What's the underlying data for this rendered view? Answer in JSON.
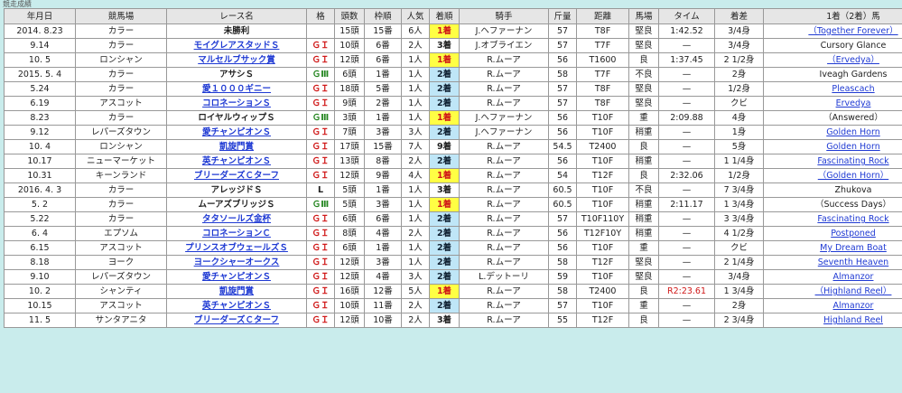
{
  "caption": "競走成績",
  "headers": [
    "年月日",
    "競馬場",
    "レース名",
    "格",
    "頭数",
    "枠順",
    "人気",
    "着順",
    "騎手",
    "斤量",
    "距離",
    "馬場",
    "タイム",
    "着差",
    "1着（2着）馬"
  ],
  "rows": [
    {
      "date": "2014. 8.23",
      "course": "カラー",
      "race": "未勝利",
      "race_link": false,
      "grade": "",
      "grade_class": "",
      "runners": "15頭",
      "draw": "15番",
      "pop": "6人",
      "finish": "1着",
      "finish_class": "win",
      "jockey": "J.ヘファーナン",
      "weight": "57",
      "distance": "T8F",
      "going": "堅良",
      "time": "1:42.52",
      "time_red": false,
      "margin": "3/4身",
      "horse": "（Together Forever）",
      "horse_link": true
    },
    {
      "date": "9.14",
      "course": "カラー",
      "race": "モイグレアスタッドＳ",
      "race_link": true,
      "grade": "ＧＩ",
      "grade_class": "g1",
      "runners": "10頭",
      "draw": "6番",
      "pop": "2人",
      "finish": "3着",
      "finish_class": "other",
      "jockey": "J.オブライエン",
      "weight": "57",
      "distance": "T7F",
      "going": "堅良",
      "time": "—",
      "time_red": false,
      "margin": "3/4身",
      "horse": "Cursory Glance",
      "horse_link": false
    },
    {
      "date": "10. 5",
      "course": "ロンシャン",
      "race": "マルセルブサック賞",
      "race_link": true,
      "grade": "ＧＩ",
      "grade_class": "g1",
      "runners": "12頭",
      "draw": "6番",
      "pop": "1人",
      "finish": "1着",
      "finish_class": "win",
      "jockey": "R.ムーア",
      "weight": "56",
      "distance": "T1600",
      "going": "良",
      "time": "1:37.45",
      "time_red": false,
      "margin": "2 1/2身",
      "horse": "（Ervedya）",
      "horse_link": true
    },
    {
      "date": "2015. 5. 4",
      "course": "カラー",
      "race": "アサシＳ",
      "race_link": false,
      "grade": "ＧⅢ",
      "grade_class": "g3",
      "runners": "6頭",
      "draw": "1番",
      "pop": "1人",
      "finish": "2着",
      "finish_class": "place",
      "jockey": "R.ムーア",
      "weight": "58",
      "distance": "T7F",
      "going": "不良",
      "time": "—",
      "time_red": false,
      "margin": "2身",
      "horse": "Iveagh Gardens",
      "horse_link": false
    },
    {
      "date": "5.24",
      "course": "カラー",
      "race": "愛１０００ギニー",
      "race_link": true,
      "grade": "ＧＩ",
      "grade_class": "g1",
      "runners": "18頭",
      "draw": "5番",
      "pop": "1人",
      "finish": "2着",
      "finish_class": "place",
      "jockey": "R.ムーア",
      "weight": "57",
      "distance": "T8F",
      "going": "堅良",
      "time": "—",
      "time_red": false,
      "margin": "1/2身",
      "horse": "Pleascach",
      "horse_link": true
    },
    {
      "date": "6.19",
      "course": "アスコット",
      "race": "コロネーションＳ",
      "race_link": true,
      "grade": "ＧＩ",
      "grade_class": "g1",
      "runners": "9頭",
      "draw": "2番",
      "pop": "1人",
      "finish": "2着",
      "finish_class": "place",
      "jockey": "R.ムーア",
      "weight": "57",
      "distance": "T8F",
      "going": "堅良",
      "time": "—",
      "time_red": false,
      "margin": "クビ",
      "horse": "Ervedya",
      "horse_link": true
    },
    {
      "date": "8.23",
      "course": "カラー",
      "race": "ロイヤルウィップＳ",
      "race_link": false,
      "grade": "ＧⅢ",
      "grade_class": "g3",
      "runners": "3頭",
      "draw": "1番",
      "pop": "1人",
      "finish": "1着",
      "finish_class": "win",
      "jockey": "J.ヘファーナン",
      "weight": "56",
      "distance": "T10F",
      "going": "重",
      "time": "2:09.88",
      "time_red": false,
      "margin": "4身",
      "horse": "（Answered）",
      "horse_link": false
    },
    {
      "date": "9.12",
      "course": "レパーズタウン",
      "race": "愛チャンピオンＳ",
      "race_link": true,
      "grade": "ＧＩ",
      "grade_class": "g1",
      "runners": "7頭",
      "draw": "3番",
      "pop": "3人",
      "finish": "2着",
      "finish_class": "place",
      "jockey": "J.ヘファーナン",
      "weight": "56",
      "distance": "T10F",
      "going": "稍重",
      "time": "—",
      "time_red": false,
      "margin": "1身",
      "horse": "Golden Horn",
      "horse_link": true
    },
    {
      "date": "10. 4",
      "course": "ロンシャン",
      "race": "凱旋門賞",
      "race_link": true,
      "grade": "ＧＩ",
      "grade_class": "g1",
      "runners": "17頭",
      "draw": "15番",
      "pop": "7人",
      "finish": "9着",
      "finish_class": "other",
      "jockey": "R.ムーア",
      "weight": "54.5",
      "distance": "T2400",
      "going": "良",
      "time": "—",
      "time_red": false,
      "margin": "5身",
      "horse": "Golden Horn",
      "horse_link": true
    },
    {
      "date": "10.17",
      "course": "ニューマーケット",
      "race": "英チャンピオンＳ",
      "race_link": true,
      "grade": "ＧＩ",
      "grade_class": "g1",
      "runners": "13頭",
      "draw": "8番",
      "pop": "2人",
      "finish": "2着",
      "finish_class": "place",
      "jockey": "R.ムーア",
      "weight": "56",
      "distance": "T10F",
      "going": "稍重",
      "time": "—",
      "time_red": false,
      "margin": "1 1/4身",
      "horse": "Fascinating Rock",
      "horse_link": true
    },
    {
      "date": "10.31",
      "course": "キーンランド",
      "race": "ブリーダーズＣターフ",
      "race_link": true,
      "grade": "ＧＩ",
      "grade_class": "g1",
      "runners": "12頭",
      "draw": "9番",
      "pop": "4人",
      "finish": "1着",
      "finish_class": "win",
      "jockey": "R.ムーア",
      "weight": "54",
      "distance": "T12F",
      "going": "良",
      "time": "2:32.06",
      "time_red": false,
      "margin": "1/2身",
      "horse": "（Golden Horn）",
      "horse_link": true
    },
    {
      "date": "2016. 4. 3",
      "course": "カラー",
      "race": "アレッジドＳ",
      "race_link": false,
      "grade": "L",
      "grade_class": "l",
      "runners": "5頭",
      "draw": "1番",
      "pop": "1人",
      "finish": "3着",
      "finish_class": "other",
      "jockey": "R.ムーア",
      "weight": "60.5",
      "distance": "T10F",
      "going": "不良",
      "time": "—",
      "time_red": false,
      "margin": "7 3/4身",
      "horse": "Zhukova",
      "horse_link": false
    },
    {
      "date": "5. 2",
      "course": "カラー",
      "race": "ムーアズブリッジＳ",
      "race_link": false,
      "grade": "ＧⅢ",
      "grade_class": "g3",
      "runners": "5頭",
      "draw": "3番",
      "pop": "1人",
      "finish": "1着",
      "finish_class": "win",
      "jockey": "R.ムーア",
      "weight": "60.5",
      "distance": "T10F",
      "going": "稍重",
      "time": "2:11.17",
      "time_red": false,
      "margin": "1 3/4身",
      "horse": "（Success Days）",
      "horse_link": false
    },
    {
      "date": "5.22",
      "course": "カラー",
      "race": "タタソールズ金杯",
      "race_link": true,
      "grade": "ＧＩ",
      "grade_class": "g1",
      "runners": "6頭",
      "draw": "6番",
      "pop": "1人",
      "finish": "2着",
      "finish_class": "place",
      "jockey": "R.ムーア",
      "weight": "57",
      "distance": "T10F110Y",
      "going": "稍重",
      "time": "—",
      "time_red": false,
      "margin": "3 3/4身",
      "horse": "Fascinating Rock",
      "horse_link": true
    },
    {
      "date": "6. 4",
      "course": "エプソム",
      "race": "コロネーションＣ",
      "race_link": true,
      "grade": "ＧＩ",
      "grade_class": "g1",
      "runners": "8頭",
      "draw": "4番",
      "pop": "2人",
      "finish": "2着",
      "finish_class": "place",
      "jockey": "R.ムーア",
      "weight": "56",
      "distance": "T12F10Y",
      "going": "稍重",
      "time": "—",
      "time_red": false,
      "margin": "4 1/2身",
      "horse": "Postponed",
      "horse_link": true
    },
    {
      "date": "6.15",
      "course": "アスコット",
      "race": "プリンスオブウェールズＳ",
      "race_link": true,
      "grade": "ＧＩ",
      "grade_class": "g1",
      "runners": "6頭",
      "draw": "1番",
      "pop": "1人",
      "finish": "2着",
      "finish_class": "place",
      "jockey": "R.ムーア",
      "weight": "56",
      "distance": "T10F",
      "going": "重",
      "time": "—",
      "time_red": false,
      "margin": "クビ",
      "horse": "My Dream Boat",
      "horse_link": true
    },
    {
      "date": "8.18",
      "course": "ヨーク",
      "race": "ヨークシャーオークス",
      "race_link": true,
      "grade": "ＧＩ",
      "grade_class": "g1",
      "runners": "12頭",
      "draw": "3番",
      "pop": "1人",
      "finish": "2着",
      "finish_class": "place",
      "jockey": "R.ムーア",
      "weight": "58",
      "distance": "T12F",
      "going": "堅良",
      "time": "—",
      "time_red": false,
      "margin": "2 1/4身",
      "horse": "Seventh Heaven",
      "horse_link": true
    },
    {
      "date": "9.10",
      "course": "レパーズタウン",
      "race": "愛チャンピオンＳ",
      "race_link": true,
      "grade": "ＧＩ",
      "grade_class": "g1",
      "runners": "12頭",
      "draw": "4番",
      "pop": "3人",
      "finish": "2着",
      "finish_class": "place",
      "jockey": "L.デットーリ",
      "weight": "59",
      "distance": "T10F",
      "going": "堅良",
      "time": "—",
      "time_red": false,
      "margin": "3/4身",
      "horse": "Almanzor",
      "horse_link": true
    },
    {
      "date": "10. 2",
      "course": "シャンティ",
      "race": "凱旋門賞",
      "race_link": true,
      "grade": "ＧＩ",
      "grade_class": "g1",
      "runners": "16頭",
      "draw": "12番",
      "pop": "5人",
      "finish": "1着",
      "finish_class": "win",
      "jockey": "R.ムーア",
      "weight": "58",
      "distance": "T2400",
      "going": "良",
      "time": "R2:23.61",
      "time_red": true,
      "margin": "1 3/4身",
      "horse": "（Highland Reel）",
      "horse_link": true
    },
    {
      "date": "10.15",
      "course": "アスコット",
      "race": "英チャンピオンＳ",
      "race_link": true,
      "grade": "ＧＩ",
      "grade_class": "g1",
      "runners": "10頭",
      "draw": "11番",
      "pop": "2人",
      "finish": "2着",
      "finish_class": "place",
      "jockey": "R.ムーア",
      "weight": "57",
      "distance": "T10F",
      "going": "重",
      "time": "—",
      "time_red": false,
      "margin": "2身",
      "horse": "Almanzor",
      "horse_link": true
    },
    {
      "date": "11. 5",
      "course": "サンタアニタ",
      "race": "ブリーダーズＣターフ",
      "race_link": true,
      "grade": "ＧＩ",
      "grade_class": "g1",
      "runners": "12頭",
      "draw": "10番",
      "pop": "2人",
      "finish": "3着",
      "finish_class": "other",
      "jockey": "R.ムーア",
      "weight": "55",
      "distance": "T12F",
      "going": "良",
      "time": "—",
      "time_red": false,
      "margin": "2 3/4身",
      "horse": "Highland Reel",
      "horse_link": true
    }
  ]
}
